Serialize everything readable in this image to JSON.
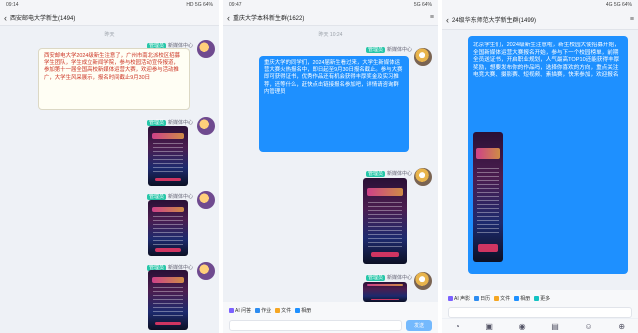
{
  "panels": [
    {
      "status": {
        "time": "09:14",
        "right": "HD 5G 64%"
      },
      "title": "西安邮电大学新生(1494)",
      "back_icon": "back-arrow-icon",
      "timestamp": "昨天",
      "messages": [
        {
          "sender_tag": "管理员",
          "sender": "新媒体中心",
          "type": "text",
          "text": "西安邮电大学2024级新生注意了，广州市南北派校区招募学生团队，学生成立新闻学院，参与校园活动宣传报道，参加第十一届全国高校新媒体运营大赛，欢迎参与活动推广，大学生风采展示，报名时间截止9月30日"
        },
        {
          "sender_tag": "管理员",
          "sender": "新媒体中心",
          "type": "image"
        },
        {
          "sender_tag": "管理员",
          "sender": "新媒体中心",
          "type": "image"
        },
        {
          "sender_tag": "管理员",
          "sender": "新媒体中心",
          "type": "image"
        }
      ]
    },
    {
      "status": {
        "time": "09:47",
        "right": "5G 64%"
      },
      "title": "重庆大学本科新生群(1622)",
      "back_icon": "back-arrow-icon",
      "more_icon": "more-icon",
      "timestamp": "昨天 10:24",
      "messages": [
        {
          "sender_tag": "管理员",
          "sender": "新媒体中心",
          "type": "text",
          "text": "重庆大学的同学们，2024届新生看过来，大学生新媒体运营大赛火热报名中，即日起至9月30日报名截止。参与大赛即可获得证书，优秀作品还有机会获得丰厚奖金及实习推荐，还等什么，赶快点击链接报名参加吧，详情请咨询群内管理员"
        },
        {
          "sender_tag": "管理员",
          "sender": "新媒体中心",
          "type": "image"
        },
        {
          "sender_tag": "管理员",
          "sender": "新媒体中心",
          "type": "image"
        }
      ],
      "toolbar": [
        {
          "label": "AI 问答",
          "icon": "ai-icon"
        },
        {
          "label": "作业",
          "icon": "homework-icon"
        },
        {
          "label": "文件",
          "icon": "file-icon"
        },
        {
          "label": "相册",
          "icon": "album-icon"
        }
      ],
      "send_label": "发送"
    },
    {
      "status": {
        "time": "",
        "right": "4G 5G 64%"
      },
      "title": "24级华东师范大学新生群(1499)",
      "back_icon": "back-arrow-icon",
      "more_icon": "more-icon",
      "messages": [
        {
          "type": "text",
          "text": "北京学生们，2024级新生注意啦，新生校园大使招募开始，全国新媒体运营大赛报名开始，参与下一个校园榜单，前期全员送证书，开启职业规划，人气最高TOP10还能获得丰厚奖励，想要发布你的作品吗，选择你喜欢的方向，重点关注电竞大赛、摄影赛、短视频、素描赛，快来参加，欢迎报名"
        },
        {
          "type": "image"
        }
      ],
      "toolbar": [
        {
          "label": "AI 声影",
          "icon": "ai-icon"
        },
        {
          "label": "日历",
          "icon": "calendar-icon"
        },
        {
          "label": "文件",
          "icon": "file-icon"
        },
        {
          "label": "相册",
          "icon": "album-icon"
        },
        {
          "label": "更多",
          "icon": "more-apps-icon"
        }
      ],
      "bottom_icons": [
        "voice-icon",
        "image-icon",
        "camera-icon",
        "redpacket-icon",
        "emoji-icon",
        "plus-icon"
      ]
    }
  ],
  "colors": {
    "bubble_blue": "#1e90ff",
    "admin_tag": "#26c6a8",
    "chat_bg": "#eef1f6",
    "white_bubble_text": "#cc3322"
  }
}
